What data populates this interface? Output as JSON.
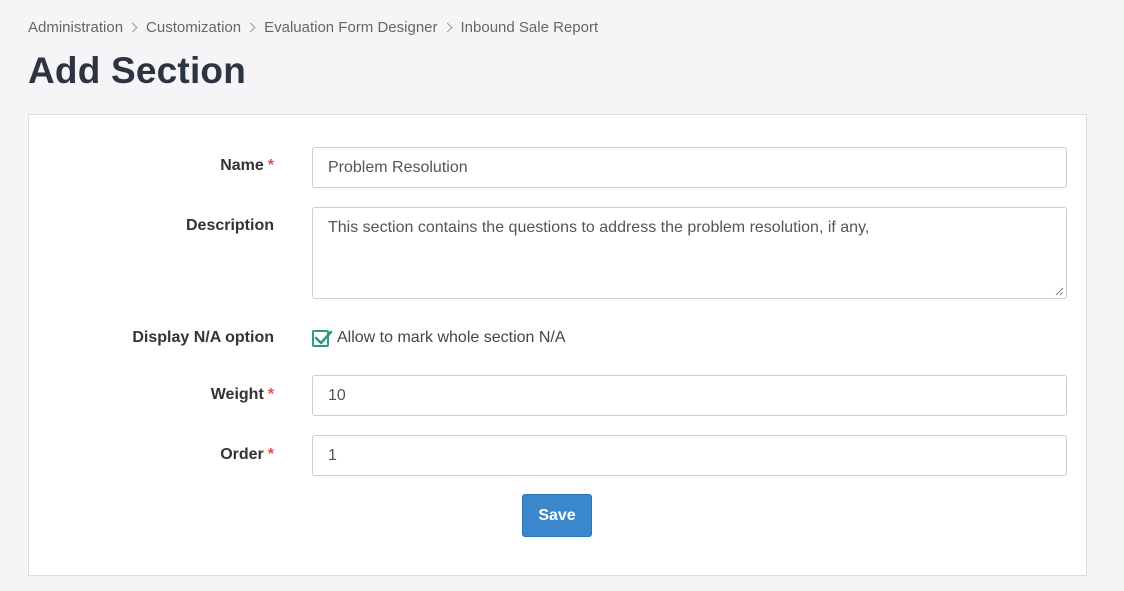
{
  "breadcrumb": [
    "Administration",
    "Customization",
    "Evaluation Form Designer",
    "Inbound Sale Report"
  ],
  "page_title": "Add Section",
  "form": {
    "name": {
      "label": "Name",
      "required_mark": "*",
      "value": "Problem Resolution"
    },
    "description": {
      "label": "Description",
      "value": "This section contains the questions to address the problem resolution, if any,"
    },
    "display_na": {
      "label": "Display N/A option",
      "checkbox_label": "Allow to mark whole section N/A",
      "checked": true
    },
    "weight": {
      "label": "Weight",
      "required_mark": "*",
      "value": "10"
    },
    "order": {
      "label": "Order",
      "required_mark": "*",
      "value": "1"
    },
    "save_label": "Save"
  },
  "colors": {
    "accent": "#3a87cc",
    "check": "#2e9a87",
    "required": "#d9534f",
    "title": "#2b3440"
  }
}
